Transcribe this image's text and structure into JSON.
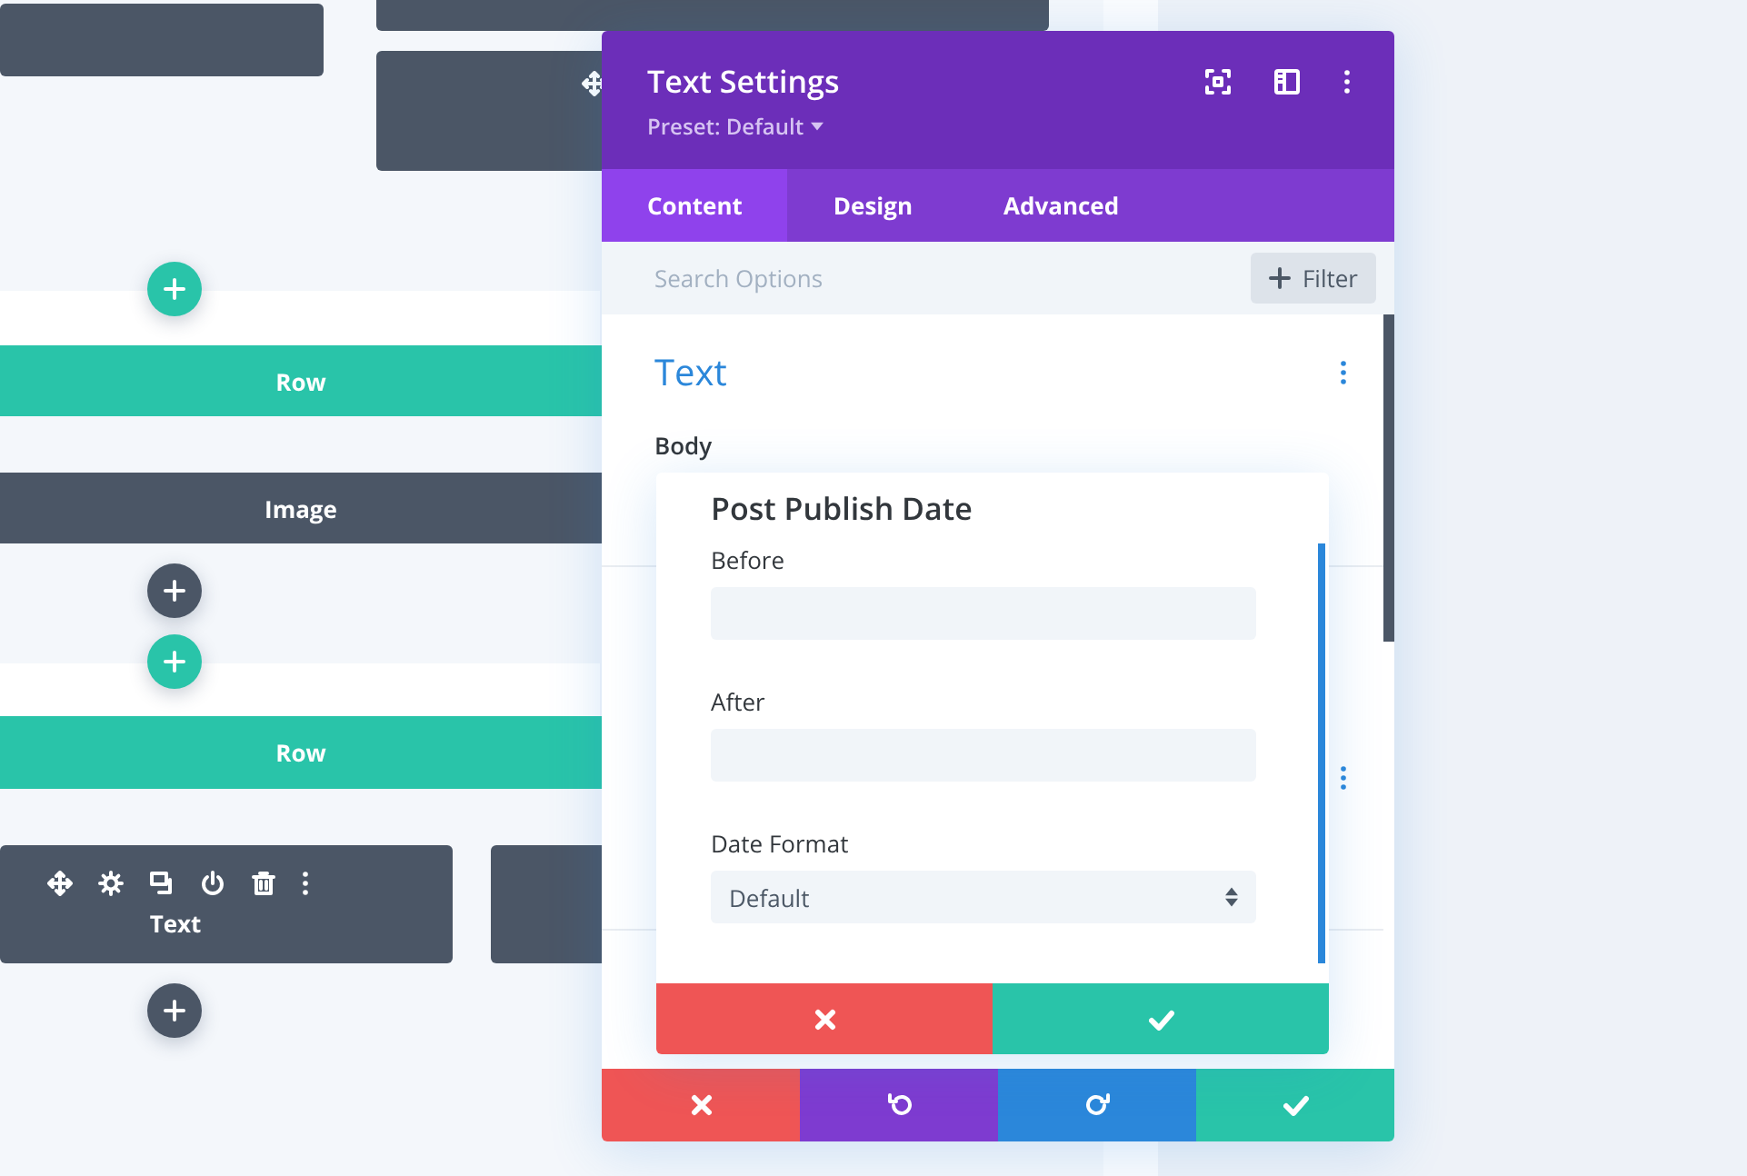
{
  "canvas": {
    "items": [
      {
        "kind": "module"
      },
      {
        "kind": "module"
      },
      {
        "kind": "module",
        "move_handle": true
      },
      {
        "kind": "add-row"
      },
      {
        "kind": "row",
        "label": "Row"
      },
      {
        "kind": "module",
        "label": "Image"
      },
      {
        "kind": "add-module"
      },
      {
        "kind": "add-row"
      },
      {
        "kind": "row",
        "label": "Row"
      },
      {
        "kind": "module",
        "label": "Text",
        "hovered": true
      },
      {
        "kind": "module"
      },
      {
        "kind": "add-module"
      }
    ]
  },
  "modal": {
    "title": "Text Settings",
    "preset": "Preset: Default",
    "tabs": [
      {
        "label": "Content",
        "selected": true
      },
      {
        "label": "Design",
        "selected": false
      },
      {
        "label": "Advanced",
        "selected": false
      }
    ],
    "search": {
      "placeholder": "Search Options"
    },
    "filter_button": "Filter",
    "section": {
      "title": "Text",
      "field_label": "Body"
    },
    "popup": {
      "title": "Post Publish Date",
      "fields": [
        {
          "kind": "text",
          "label": "Before"
        },
        {
          "kind": "text",
          "label": "After"
        },
        {
          "kind": "select",
          "label": "Date Format",
          "value": "Default"
        }
      ]
    }
  }
}
